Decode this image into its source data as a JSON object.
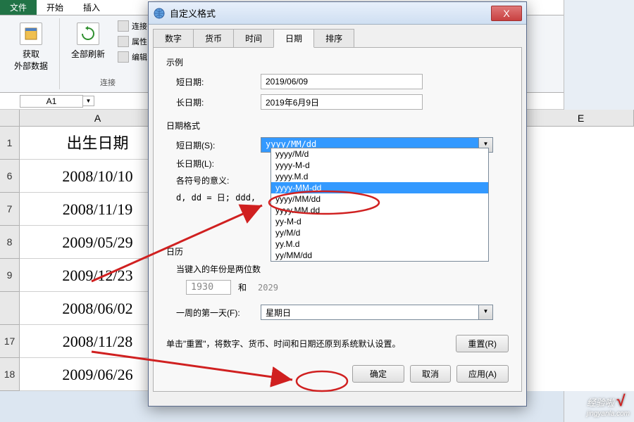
{
  "ribbon": {
    "tabs": {
      "file": "文件",
      "home": "开始",
      "insert": "插入"
    },
    "group1": {
      "getData": "获取\n外部数据",
      "label": ""
    },
    "group2": {
      "refresh": "全部刷新",
      "connections": "连接",
      "properties": "属性",
      "editLinks": "编辑",
      "label": "连接"
    }
  },
  "nameBox": "A1",
  "cols": {
    "a": "A",
    "e": "E"
  },
  "rows": [
    {
      "num": "1",
      "val": "出生日期"
    },
    {
      "num": "6",
      "val": "2008/10/10"
    },
    {
      "num": "7",
      "val": "2008/11/19"
    },
    {
      "num": "8",
      "val": "2009/05/29"
    },
    {
      "num": "9",
      "val": "2009/12/23"
    },
    {
      "num": "",
      "val": "2008/06/02"
    },
    {
      "num": "17",
      "val": "2008/11/28"
    },
    {
      "num": "18",
      "val": "2009/06/26"
    }
  ],
  "dialog": {
    "title": "自定义格式",
    "closeX": "X",
    "tabs": {
      "number": "数字",
      "currency": "货币",
      "time": "时间",
      "date": "日期",
      "sort": "排序"
    },
    "example": {
      "title": "示例",
      "shortDate": "短日期:",
      "shortDateVal": "2019/06/09",
      "longDate": "长日期:",
      "longDateVal": "2019年6月9日"
    },
    "dateFormat": {
      "title": "日期格式",
      "shortDateS": "短日期(S):",
      "shortDateSVal": "yyyy/MM/dd",
      "longDateL": "长日期(L):",
      "symbolMeaning": "各符号的意义:",
      "symbolLine": "d, dd = 日;   ddd,"
    },
    "dropdown": [
      "yyyy/M/d",
      "yyyy-M-d",
      "yyyy.M.d",
      "yyyy-MM-dd",
      "yyyy/MM/dd",
      "yyyy.MM.dd",
      "yy-M-d",
      "yy/M/d",
      "yy.M.d",
      "yy/MM/dd"
    ],
    "calendar": {
      "title": "日历",
      "twoDigit": "当键入的年份是两位数",
      "year1": "1930",
      "and": "和",
      "year2": "2029"
    },
    "firstDay": {
      "label": "一周的第一天(F):",
      "val": "星期日"
    },
    "resetNote": "单击\"重置\"，将数字、货币、时间和日期还原到系统默认设置。",
    "buttons": {
      "reset": "重置(R)",
      "ok": "确定",
      "cancel": "取消",
      "apply": "应用(A)"
    }
  },
  "watermark": {
    "brand": "经验啦",
    "url": "jingyanla.com"
  }
}
